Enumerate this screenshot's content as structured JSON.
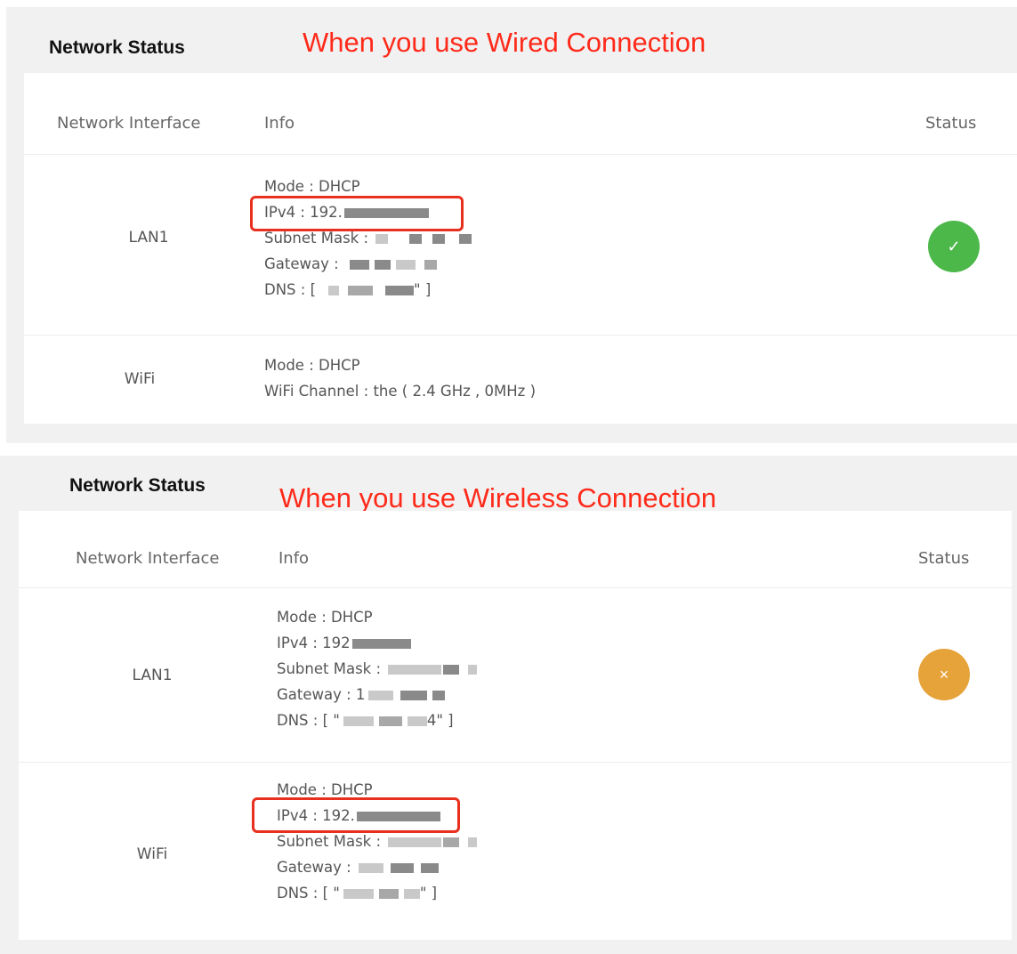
{
  "colors": {
    "ok": "#4db84a",
    "warn": "#e6a33a",
    "annotation": "#ff2a1a",
    "highlight": "#e8301f"
  },
  "panels": [
    {
      "title": "Network Status",
      "annotation": "When you use Wired Connection",
      "headers": {
        "interface": "Network Interface",
        "info": "Info",
        "status": "Status"
      },
      "lan1": {
        "name": "LAN1",
        "mode": "Mode : DHCP",
        "ipv4": "IPv4 : 192.",
        "subnet": "Subnet Mask :",
        "gateway": "Gateway :",
        "dns": "DNS : [",
        "dns_end": "\" ]",
        "status_icon": "check-icon",
        "status_glyph": "✓"
      },
      "wifi": {
        "name": "WiFi",
        "mode": "Mode : DHCP",
        "channel": "WiFi Channel : the ( 2.4 GHz , 0MHz )"
      }
    },
    {
      "title": "Network Status",
      "annotation": "When you use Wireless Connection",
      "headers": {
        "interface": "Network Interface",
        "info": "Info",
        "status": "Status"
      },
      "lan1": {
        "name": "LAN1",
        "mode": "Mode : DHCP",
        "ipv4": "IPv4 : 192",
        "subnet": "Subnet Mask :",
        "gateway": "Gateway : 1",
        "dns": "DNS : [ \"",
        "dns_end": "4\" ]",
        "status_icon": "close-icon",
        "status_glyph": "×"
      },
      "wifi": {
        "name": "WiFi",
        "mode": "Mode : DHCP",
        "ipv4": "IPv4 : 192.",
        "subnet": "Subnet Mask :",
        "gateway": "Gateway :",
        "dns": "DNS : [ \"",
        "dns_end": "\" ]"
      }
    }
  ]
}
